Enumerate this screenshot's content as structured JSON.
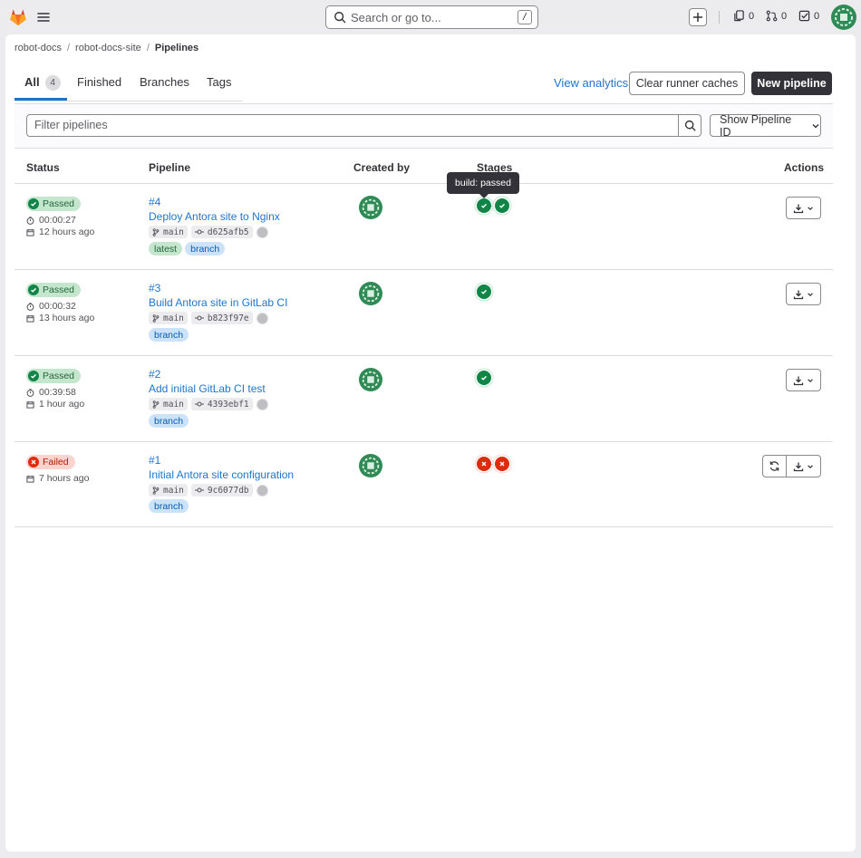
{
  "topbar": {
    "search_placeholder": "Search or go to...",
    "search_shortcut": "/",
    "issues_count": "0",
    "merge_requests_count": "0",
    "todos_count": "0"
  },
  "breadcrumb": [
    "robot-docs",
    "robot-docs-site",
    "Pipelines"
  ],
  "tabs": [
    {
      "label": "All",
      "count": "4"
    },
    {
      "label": "Finished"
    },
    {
      "label": "Branches"
    },
    {
      "label": "Tags"
    }
  ],
  "actions": {
    "view_analytics": "View analytics",
    "clear_runner_caches": "Clear runner caches",
    "new_pipeline": "New pipeline"
  },
  "filter": {
    "placeholder": "Filter pipelines",
    "pipeline_id_dropdown": "Show Pipeline ID"
  },
  "columns": {
    "status": "Status",
    "pipeline": "Pipeline",
    "created_by": "Created by",
    "stages": "Stages",
    "actions": "Actions"
  },
  "tooltip": "build: passed",
  "pipelines": [
    {
      "status": "Passed",
      "duration": "00:00:27",
      "finished": "12 hours ago",
      "id": "#4",
      "title": "Deploy Antora site to Nginx",
      "branch": "main",
      "commit": "d625afb5",
      "labels": [
        "latest",
        "branch"
      ],
      "stages": [
        "passed",
        "passed"
      ]
    },
    {
      "status": "Passed",
      "duration": "00:00:32",
      "finished": "13 hours ago",
      "id": "#3",
      "title": "Build Antora site in GitLab CI",
      "branch": "main",
      "commit": "b823f97e",
      "labels": [
        "branch"
      ],
      "stages": [
        "passed"
      ]
    },
    {
      "status": "Passed",
      "duration": "00:39:58",
      "finished": "1 hour ago",
      "id": "#2",
      "title": "Add initial GitLab CI test",
      "branch": "main",
      "commit": "4393ebf1",
      "labels": [
        "branch"
      ],
      "stages": [
        "passed"
      ]
    },
    {
      "status": "Failed",
      "finished": "7 hours ago",
      "id": "#1",
      "title": "Initial Antora site configuration",
      "branch": "main",
      "commit": "9c6077db",
      "labels": [
        "branch"
      ],
      "stages": [
        "failed",
        "failed"
      ]
    }
  ],
  "colors": {
    "accent": "#1f75cb",
    "success": "#108548",
    "danger": "#dd2b0e",
    "gitlab_orange": "#e24329"
  }
}
